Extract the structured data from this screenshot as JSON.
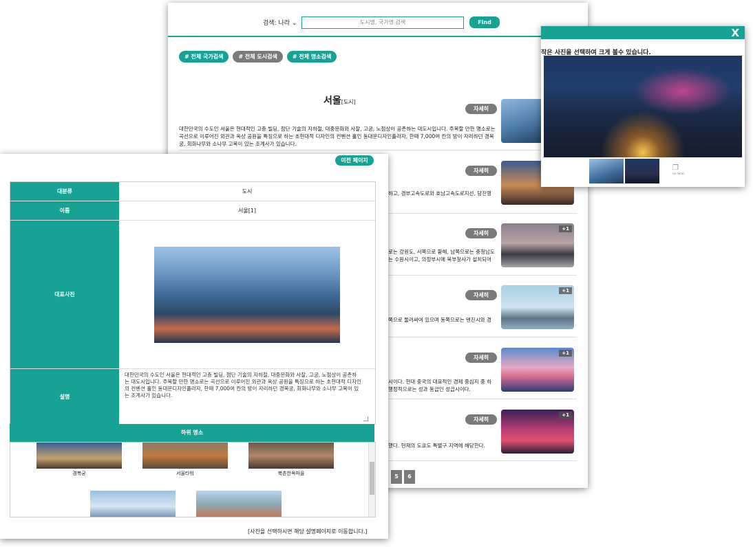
{
  "search": {
    "select_label": "검색: 나라 ⌄",
    "placeholder": "도시명, 국가명 검색",
    "find_label": "Find",
    "filters": [
      "# 전체 국가검색",
      "# 전체 도시검색",
      "# 전체 명소검색"
    ]
  },
  "results": {
    "title": "서울",
    "title_tag": "[도시]",
    "description": "대한민국의 수도인 서울은 현대적인 고층 빌딩, 첨단 기술의 지하철, 대중문화와 사찰, 고궁, 노점상이 공존하는 대도시입니다. 주목할 만한 명소로는 곡선으로 이루어진 외관과 옥상 공원을 특징으로 하는 초현대적 디자인의 컨벤션 홀인 동대문디자인플라자, 한때 7,000여 칸의 방이 자리하던 경복궁, 회화나무와 소나무 고목이 있는 조계사가 있습니다.",
    "detail_label": "자세히",
    "plus_label": "+1",
    "snippets": [
      "하고, 경부고속도로와 호남고속도로지선, 당진영",
      "로는 강원도, 서쪽으로 황해, 남쪽으로는 충청남도\n는 수원시이고, 의정부시에 북부청사가 설치되어",
      "쪽으로 둘러싸여 있으며 동쪽으로는 톈진시와 경",
      "시이다. 현대 중국의 대표적인 경제 중심지 중 하\n행정적으로는 성과 동급인 성급시이다.",
      "했다. 현재의 도쿄도 특별구 지역에 해당한다."
    ],
    "pages": [
      "5",
      "6"
    ]
  },
  "viewer": {
    "close": "X",
    "hint": "작은 사진을 선택하여 크게 볼수 있습니다.",
    "icon_caption": "no detail"
  },
  "detail": {
    "prev_label": "이전 페이지",
    "rows": {
      "category_label": "대분류",
      "category_value": "도시",
      "name_label": "이름",
      "name_value": "서울[1]",
      "photo_label": "대표사진",
      "desc_label": "설명",
      "desc_value": "대한민국의 수도인 서울은 현대적인 고층 빌딩, 첨단 기술의 지하철, 대중문화와 사찰, 고궁, 노점상이 공존하는 대도시입니다. 주목할 만한 명소로는 곡선으로 이루어진 외관과 옥상 공원을 특징으로 하는 초현대적 디자인의 컨벤션 홀인 동대문디자인플라자, 한때 7,000여 칸의 방이 자리하던 경복궁, 회화나무와 소나무 고목이 있는 조계사가 있습니다."
    },
    "sub_header": "하위 명소",
    "sub_places": [
      "경복궁",
      "서울타워",
      "북촌한옥마을"
    ],
    "footnote": "[사진을 선택하시면 해당 설명페이지로 이동합니다.]"
  }
}
